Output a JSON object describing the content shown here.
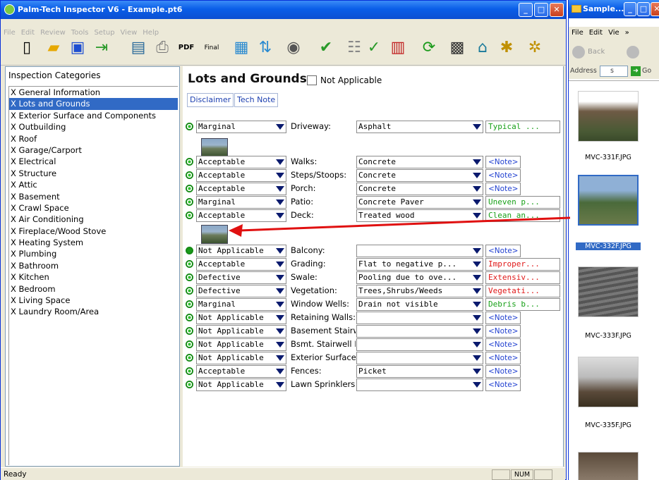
{
  "app": {
    "title": "Palm-Tech Inspector V6 - Example.pt6",
    "menu": [
      "File",
      "Edit",
      "Review",
      "Tools",
      "Setup",
      "View",
      "Help"
    ],
    "status": "Ready",
    "status_pane": "NUM"
  },
  "categories": {
    "heading": "Inspection Categories",
    "items": [
      "X  General Information",
      "X  Lots and Grounds",
      "X  Exterior Surface and Components",
      "X  Outbuilding",
      "X  Roof",
      "X  Garage/Carport",
      "X  Electrical",
      "X  Structure",
      "X  Attic",
      "X  Basement",
      "X  Crawl Space",
      "X  Air Conditioning",
      "X  Fireplace/Wood Stove",
      "X  Heating System",
      "X  Plumbing",
      "X  Bathroom",
      "X  Kitchen",
      "X  Bedroom",
      "X  Living Space",
      "X  Laundry Room/Area"
    ],
    "selected_index": 1
  },
  "section": {
    "title": "Lots and Grounds",
    "not_applicable": "Not Applicable",
    "disclaimer": "Disclaimer",
    "tech_note": "Tech Note"
  },
  "rows": [
    {
      "rating": "Marginal",
      "label": "Driveway:",
      "value": "Asphalt",
      "note": "Typical ...",
      "note_color": "green"
    },
    {
      "rating": "Acceptable",
      "label": "Walks:",
      "value": "Concrete",
      "note": "<Note>",
      "note_color": "blue"
    },
    {
      "rating": "Acceptable",
      "label": "Steps/Stoops:",
      "value": "Concrete",
      "note": "<Note>",
      "note_color": "blue"
    },
    {
      "rating": "Acceptable",
      "label": "Porch:",
      "value": "Concrete",
      "note": "<Note>",
      "note_color": "blue"
    },
    {
      "rating": "Marginal",
      "label": "Patio:",
      "value": "Concrete Paver",
      "note": "Uneven p...",
      "note_color": "green"
    },
    {
      "rating": "Acceptable",
      "label": "Deck:",
      "value": "Treated wood",
      "note": "Clean an...",
      "note_color": "green"
    },
    {
      "rating": "Not Applicable",
      "label": "Balcony:",
      "value": "",
      "note": "<Note>",
      "note_color": "blue"
    },
    {
      "rating": "Acceptable",
      "label": "Grading:",
      "value": "Flat to negative p...",
      "note": "Improper...",
      "note_color": "red"
    },
    {
      "rating": "Defective",
      "label": "Swale:",
      "value": "Pooling due to ove...",
      "note": "Extensiv...",
      "note_color": "red"
    },
    {
      "rating": "Defective",
      "label": "Vegetation:",
      "value": "Trees,Shrubs/Weeds",
      "note": "Vegetati...",
      "note_color": "red"
    },
    {
      "rating": "Marginal",
      "label": "Window Wells:",
      "value": "Drain not visible",
      "note": "Debris b...",
      "note_color": "green"
    },
    {
      "rating": "Not Applicable",
      "label": "Retaining Walls:",
      "value": "",
      "note": "<Note>",
      "note_color": "blue"
    },
    {
      "rating": "Not Applicable",
      "label": "Basement Stairw",
      "value": "",
      "note": "<Note>",
      "note_color": "blue"
    },
    {
      "rating": "Not Applicable",
      "label": "Bsmt. Stairwell D",
      "value": "",
      "note": "<Note>",
      "note_color": "blue"
    },
    {
      "rating": "Not Applicable",
      "label": "Exterior Surface",
      "value": "",
      "note": "<Note>",
      "note_color": "blue"
    },
    {
      "rating": "Acceptable",
      "label": "Fences:",
      "value": "Picket",
      "note": "<Note>",
      "note_color": "blue"
    },
    {
      "rating": "Not Applicable",
      "label": "Lawn Sprinklers:",
      "value": "",
      "note": "<Note>",
      "note_color": "blue"
    }
  ],
  "explorer": {
    "title": "Sample...",
    "menu": [
      "File",
      "Edit",
      "Vie"
    ],
    "back": "Back",
    "address_label": "Address",
    "address_value": "s",
    "go": "Go",
    "files": [
      "MVC-331F.JPG",
      "MVC-332F.JPG",
      "MVC-333F.JPG",
      "MVC-335F.JPG"
    ],
    "selected_file_index": 1
  }
}
